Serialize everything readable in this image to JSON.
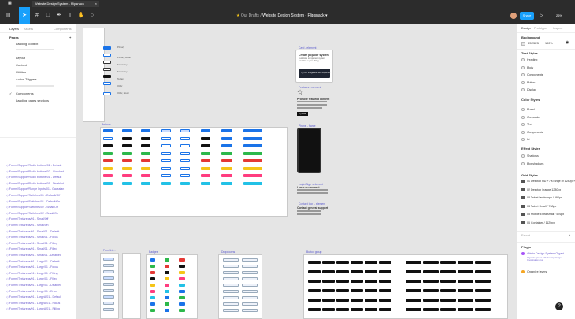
{
  "tab": {
    "title": "Website Design System - Flipsnack",
    "close": "×"
  },
  "toolbar": {
    "breadcrumb_folder": "Our Drafts",
    "breadcrumb_sep": "/",
    "file_name": "Website Design System - Flipsnack",
    "chevron": "▾",
    "share_label": "Share",
    "zoom": "26%"
  },
  "left": {
    "tabs": [
      "Layers",
      "Assets",
      "Components"
    ],
    "pages_header": "Pages",
    "pages_add": "+",
    "pages": [
      "Landing context",
      "Layout",
      "Content",
      "Utilities",
      "Action Triggers"
    ],
    "components_header": "Components",
    "components_item": "Landing pages sections",
    "layers": [
      "Forms/Support/Radio buttons/02 - Default",
      "Forms/Support/Radio buttons/02 - Checked",
      "Forms/Support/Radio buttons/01 - Default",
      "Forms/Support/Radio buttons/01 - Disabled",
      "Forms/Support/Range Inputs/01 - Gaussian",
      "Forms/Support/Switches/01 - Default/Off",
      "Forms/Support/Switches/01 - Default/On",
      "Forms/Support/Switches/02 - Small/Off",
      "Forms/Support/Switches/02 - Small/On",
      "Forms/Textareas/01 - Small/Off",
      "Forms/Textareas/01 - Small/On",
      "Forms/Textareas/01 - Small/01 - Default",
      "Forms/Textareas/01 - Small/01 - Focus",
      "Forms/Textareas/01 - Small/01 - Filling",
      "Forms/Textareas/01 - Small/01 - Filled",
      "Forms/Textareas/01 - Small/01 - Disabled",
      "Forms/Textareas/01 - Large/01 - Default",
      "Forms/Textareas/01 - Large/01 - Focus",
      "Forms/Textareas/01 - Large/01 - Filling",
      "Forms/Textareas/01 - Large/01 - Filled",
      "Forms/Textareas/01 - Large/01 - Disabled",
      "Forms/Textareas/01 - Large/01 - Error",
      "Forms/Textareas/01 - LargeA/01 - Default",
      "Forms/Textareas/01 - LargeA/01 - Focus",
      "Forms/Textareas/01 - LargeA/01 - Filling"
    ]
  },
  "canvas": {
    "labels": {
      "buttons": "Buttons",
      "card": "Card - element",
      "features": "Features - element",
      "phone": "Phone - frame",
      "login": "Login/Sign - element",
      "contact": "Contact Icon - element",
      "forms": "Form/Lis...",
      "badges": "Badges",
      "dropdowns": "Dropdowns",
      "button_group": "Button group"
    },
    "card": {
      "title": "Create popular system",
      "body": "A website component system would be a great thing",
      "dark_text": "Try our integration with Flipsnack"
    },
    "features": {
      "title": "Promote featured content",
      "cta": "Try Now"
    },
    "login": {
      "heading": "I have an account"
    },
    "contact": {
      "heading": "Contact general support"
    },
    "button_texts": [
      "Primary",
      "Primary, Hover",
      "Secondary",
      "Secondary",
      "Tertiary",
      "Other",
      "Other, Hover",
      "Text"
    ],
    "colors": {
      "blue": "#1a73e8",
      "green": "#2db84b",
      "red": "#e53935",
      "black": "#111111",
      "yellow": "#f5c518",
      "pink": "#ff3d7f",
      "cyan": "#22c1e6",
      "lightblue": "#c9dcff",
      "frame_label": "#5a5acd"
    }
  },
  "right": {
    "tabs": [
      "Design",
      "Prototype",
      "Inspect"
    ],
    "background_header": "Background",
    "bg_hex": "E5E5E5",
    "bg_opacity": "100%",
    "text_styles_header": "Text Styles",
    "text_styles": [
      "Heading",
      "Body",
      "Components",
      "Button",
      "Display"
    ],
    "color_styles_header": "Color Styles",
    "color_styles": [
      "Brand",
      "Greyscale",
      "Text",
      "Components",
      "Ui"
    ],
    "effect_styles_header": "Effect Styles",
    "effect_styles": [
      "Shadows",
      "Box shadows"
    ],
    "grid_styles_header": "Grid Styles",
    "grid_styles": [
      "01 Desktop HD + / a range of 1280px+",
      "02 Desktop / range 1280px",
      "03 Tablet landscape / 992px",
      "04 Tablet Small / 768px",
      "05 Mobile Extra small / 576px",
      "06 Container / 1120px"
    ],
    "export_header": "Export",
    "export_add": "+",
    "plugin_header": "Plugin",
    "plugins": [
      "Admin Design System Organi...",
      "Organize layers"
    ],
    "plugin_note": "Organize groups with Desktop Design Coordination at all",
    "help": "?"
  }
}
